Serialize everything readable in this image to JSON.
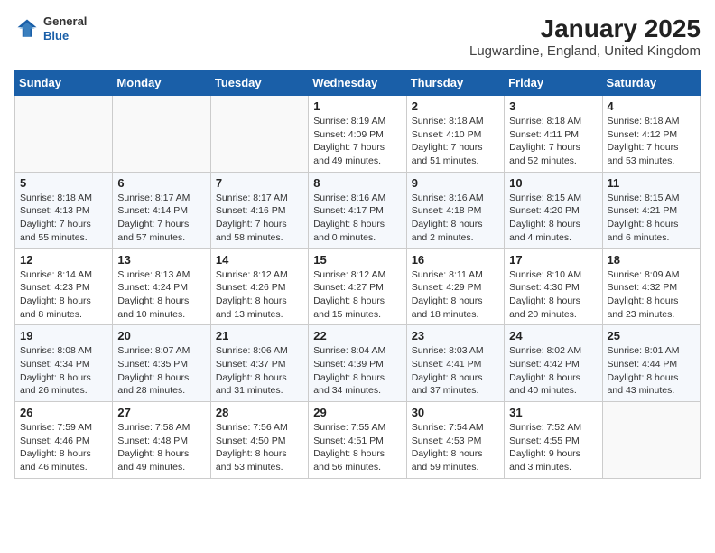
{
  "header": {
    "logo_general": "General",
    "logo_blue": "Blue",
    "title": "January 2025",
    "subtitle": "Lugwardine, England, United Kingdom"
  },
  "calendar": {
    "weekdays": [
      "Sunday",
      "Monday",
      "Tuesday",
      "Wednesday",
      "Thursday",
      "Friday",
      "Saturday"
    ],
    "weeks": [
      [
        {
          "day": "",
          "sunrise": "",
          "sunset": "",
          "daylight": ""
        },
        {
          "day": "",
          "sunrise": "",
          "sunset": "",
          "daylight": ""
        },
        {
          "day": "",
          "sunrise": "",
          "sunset": "",
          "daylight": ""
        },
        {
          "day": "1",
          "sunrise": "Sunrise: 8:19 AM",
          "sunset": "Sunset: 4:09 PM",
          "daylight": "Daylight: 7 hours and 49 minutes."
        },
        {
          "day": "2",
          "sunrise": "Sunrise: 8:18 AM",
          "sunset": "Sunset: 4:10 PM",
          "daylight": "Daylight: 7 hours and 51 minutes."
        },
        {
          "day": "3",
          "sunrise": "Sunrise: 8:18 AM",
          "sunset": "Sunset: 4:11 PM",
          "daylight": "Daylight: 7 hours and 52 minutes."
        },
        {
          "day": "4",
          "sunrise": "Sunrise: 8:18 AM",
          "sunset": "Sunset: 4:12 PM",
          "daylight": "Daylight: 7 hours and 53 minutes."
        }
      ],
      [
        {
          "day": "5",
          "sunrise": "Sunrise: 8:18 AM",
          "sunset": "Sunset: 4:13 PM",
          "daylight": "Daylight: 7 hours and 55 minutes."
        },
        {
          "day": "6",
          "sunrise": "Sunrise: 8:17 AM",
          "sunset": "Sunset: 4:14 PM",
          "daylight": "Daylight: 7 hours and 57 minutes."
        },
        {
          "day": "7",
          "sunrise": "Sunrise: 8:17 AM",
          "sunset": "Sunset: 4:16 PM",
          "daylight": "Daylight: 7 hours and 58 minutes."
        },
        {
          "day": "8",
          "sunrise": "Sunrise: 8:16 AM",
          "sunset": "Sunset: 4:17 PM",
          "daylight": "Daylight: 8 hours and 0 minutes."
        },
        {
          "day": "9",
          "sunrise": "Sunrise: 8:16 AM",
          "sunset": "Sunset: 4:18 PM",
          "daylight": "Daylight: 8 hours and 2 minutes."
        },
        {
          "day": "10",
          "sunrise": "Sunrise: 8:15 AM",
          "sunset": "Sunset: 4:20 PM",
          "daylight": "Daylight: 8 hours and 4 minutes."
        },
        {
          "day": "11",
          "sunrise": "Sunrise: 8:15 AM",
          "sunset": "Sunset: 4:21 PM",
          "daylight": "Daylight: 8 hours and 6 minutes."
        }
      ],
      [
        {
          "day": "12",
          "sunrise": "Sunrise: 8:14 AM",
          "sunset": "Sunset: 4:23 PM",
          "daylight": "Daylight: 8 hours and 8 minutes."
        },
        {
          "day": "13",
          "sunrise": "Sunrise: 8:13 AM",
          "sunset": "Sunset: 4:24 PM",
          "daylight": "Daylight: 8 hours and 10 minutes."
        },
        {
          "day": "14",
          "sunrise": "Sunrise: 8:12 AM",
          "sunset": "Sunset: 4:26 PM",
          "daylight": "Daylight: 8 hours and 13 minutes."
        },
        {
          "day": "15",
          "sunrise": "Sunrise: 8:12 AM",
          "sunset": "Sunset: 4:27 PM",
          "daylight": "Daylight: 8 hours and 15 minutes."
        },
        {
          "day": "16",
          "sunrise": "Sunrise: 8:11 AM",
          "sunset": "Sunset: 4:29 PM",
          "daylight": "Daylight: 8 hours and 18 minutes."
        },
        {
          "day": "17",
          "sunrise": "Sunrise: 8:10 AM",
          "sunset": "Sunset: 4:30 PM",
          "daylight": "Daylight: 8 hours and 20 minutes."
        },
        {
          "day": "18",
          "sunrise": "Sunrise: 8:09 AM",
          "sunset": "Sunset: 4:32 PM",
          "daylight": "Daylight: 8 hours and 23 minutes."
        }
      ],
      [
        {
          "day": "19",
          "sunrise": "Sunrise: 8:08 AM",
          "sunset": "Sunset: 4:34 PM",
          "daylight": "Daylight: 8 hours and 26 minutes."
        },
        {
          "day": "20",
          "sunrise": "Sunrise: 8:07 AM",
          "sunset": "Sunset: 4:35 PM",
          "daylight": "Daylight: 8 hours and 28 minutes."
        },
        {
          "day": "21",
          "sunrise": "Sunrise: 8:06 AM",
          "sunset": "Sunset: 4:37 PM",
          "daylight": "Daylight: 8 hours and 31 minutes."
        },
        {
          "day": "22",
          "sunrise": "Sunrise: 8:04 AM",
          "sunset": "Sunset: 4:39 PM",
          "daylight": "Daylight: 8 hours and 34 minutes."
        },
        {
          "day": "23",
          "sunrise": "Sunrise: 8:03 AM",
          "sunset": "Sunset: 4:41 PM",
          "daylight": "Daylight: 8 hours and 37 minutes."
        },
        {
          "day": "24",
          "sunrise": "Sunrise: 8:02 AM",
          "sunset": "Sunset: 4:42 PM",
          "daylight": "Daylight: 8 hours and 40 minutes."
        },
        {
          "day": "25",
          "sunrise": "Sunrise: 8:01 AM",
          "sunset": "Sunset: 4:44 PM",
          "daylight": "Daylight: 8 hours and 43 minutes."
        }
      ],
      [
        {
          "day": "26",
          "sunrise": "Sunrise: 7:59 AM",
          "sunset": "Sunset: 4:46 PM",
          "daylight": "Daylight: 8 hours and 46 minutes."
        },
        {
          "day": "27",
          "sunrise": "Sunrise: 7:58 AM",
          "sunset": "Sunset: 4:48 PM",
          "daylight": "Daylight: 8 hours and 49 minutes."
        },
        {
          "day": "28",
          "sunrise": "Sunrise: 7:56 AM",
          "sunset": "Sunset: 4:50 PM",
          "daylight": "Daylight: 8 hours and 53 minutes."
        },
        {
          "day": "29",
          "sunrise": "Sunrise: 7:55 AM",
          "sunset": "Sunset: 4:51 PM",
          "daylight": "Daylight: 8 hours and 56 minutes."
        },
        {
          "day": "30",
          "sunrise": "Sunrise: 7:54 AM",
          "sunset": "Sunset: 4:53 PM",
          "daylight": "Daylight: 8 hours and 59 minutes."
        },
        {
          "day": "31",
          "sunrise": "Sunrise: 7:52 AM",
          "sunset": "Sunset: 4:55 PM",
          "daylight": "Daylight: 9 hours and 3 minutes."
        },
        {
          "day": "",
          "sunrise": "",
          "sunset": "",
          "daylight": ""
        }
      ]
    ]
  }
}
